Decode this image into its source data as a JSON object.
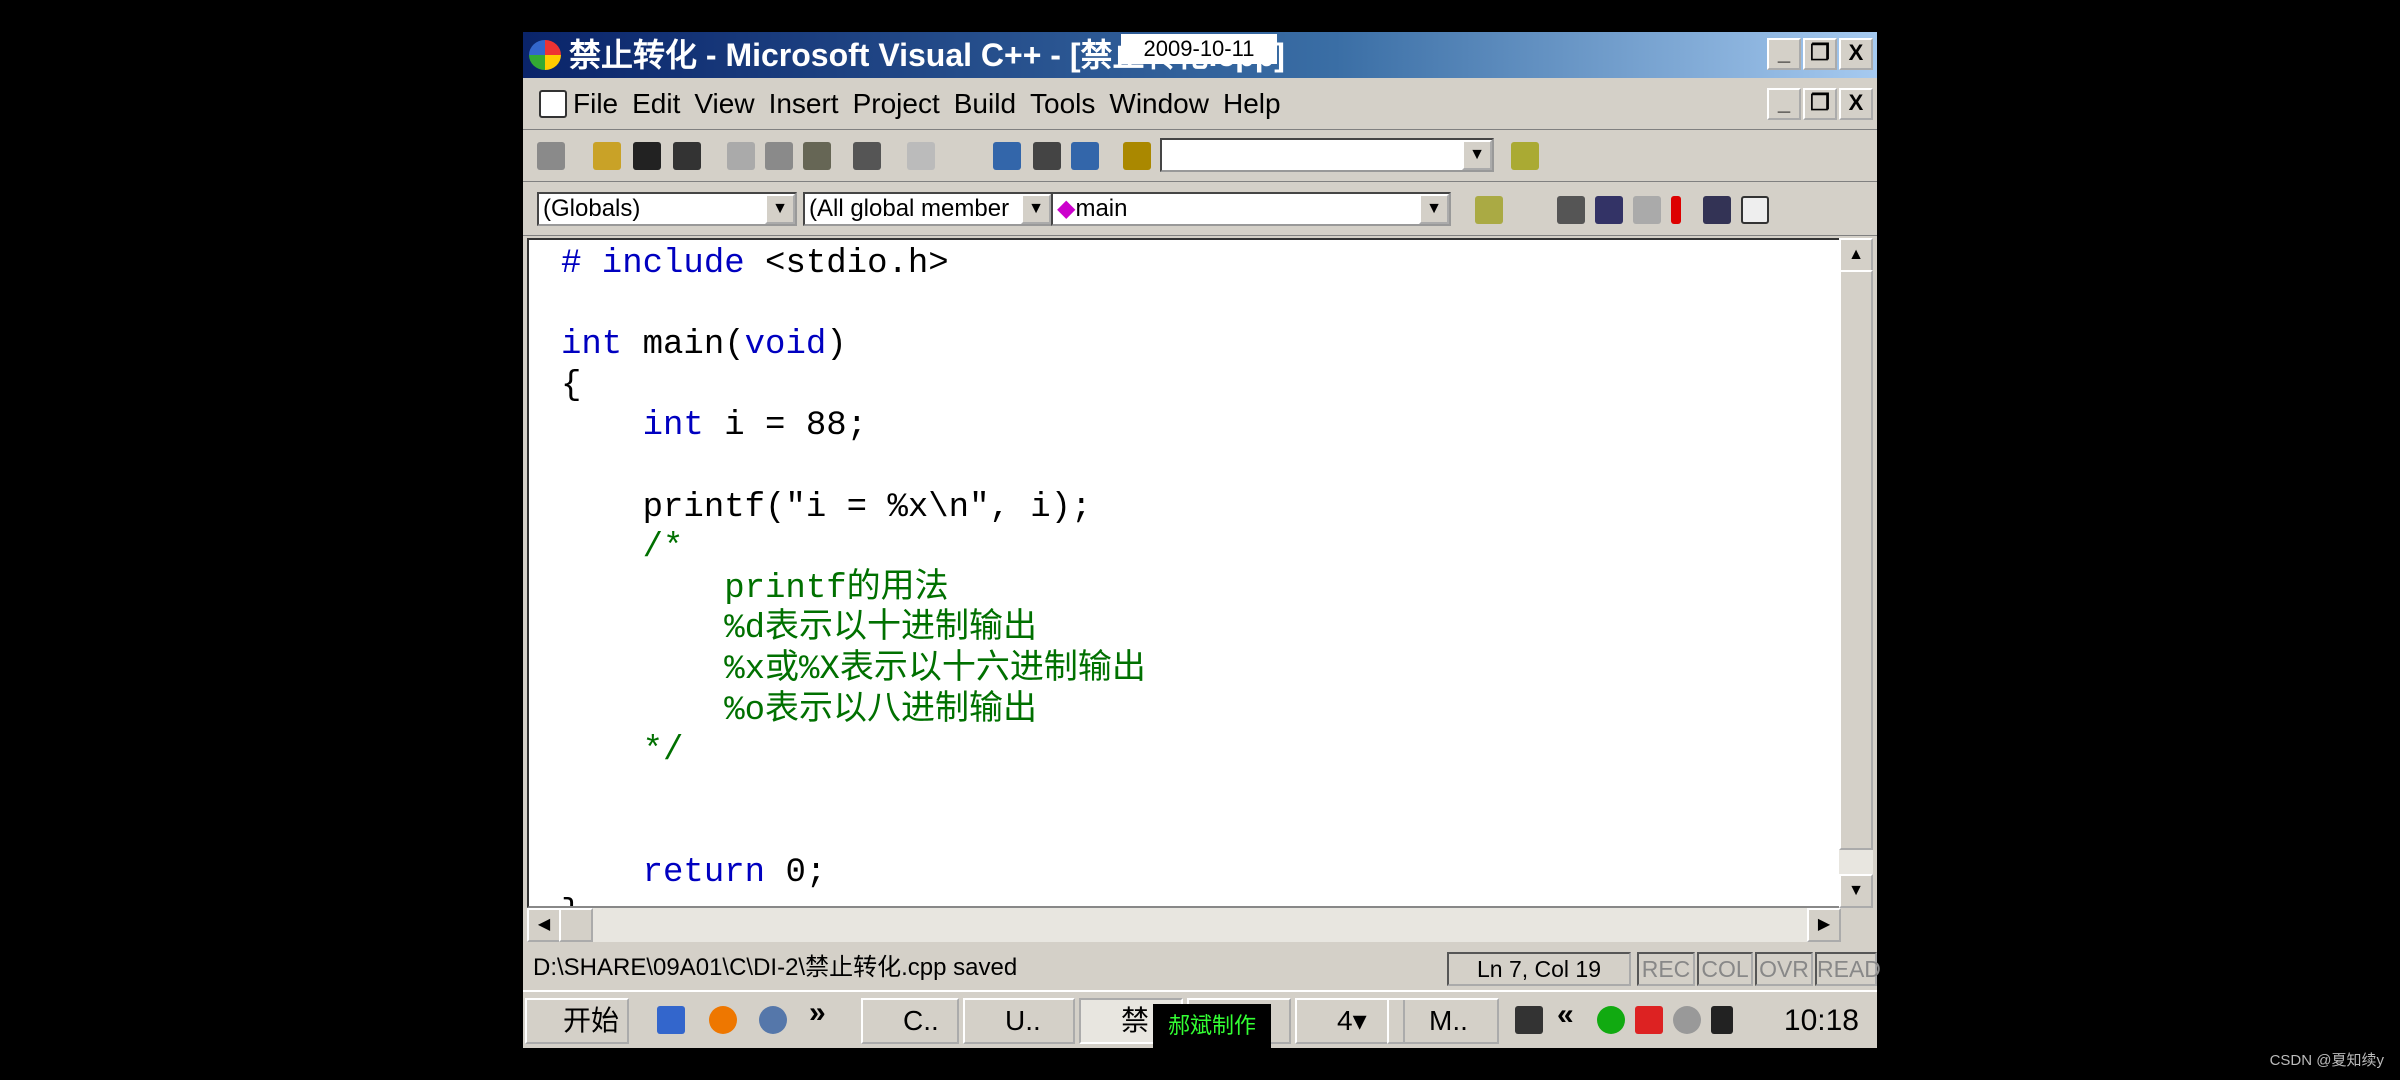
{
  "window": {
    "title": "禁止转化 - Microsoft Visual C++ - [禁止转化.cpp]",
    "overlay_date": "2009-10-11",
    "minimize": "_",
    "restore": "❐",
    "close": "X"
  },
  "menu": [
    "File",
    "Edit",
    "View",
    "Insert",
    "Project",
    "Build",
    "Tools",
    "Window",
    "Help"
  ],
  "toolbar": {
    "find_value": "",
    "scope_combo": "(Globals)",
    "members_combo": "(All global member",
    "function_combo": "main"
  },
  "code": [
    [
      [
        "kw",
        "# include "
      ],
      [
        "t",
        "<stdio.h>"
      ]
    ],
    [],
    [
      [
        "kw",
        "int"
      ],
      [
        "t",
        " main("
      ],
      [
        "kw",
        "void"
      ],
      [
        "t",
        ")"
      ]
    ],
    [
      [
        "t",
        "{"
      ]
    ],
    [
      [
        "t",
        "    "
      ],
      [
        "kw",
        "int"
      ],
      [
        "t",
        " i = 88;"
      ]
    ],
    [],
    [
      [
        "t",
        "    printf(\"i = %x\\n\", i);"
      ]
    ],
    [
      [
        "cm",
        "    /*"
      ]
    ],
    [
      [
        "cm",
        "        printf的用法"
      ]
    ],
    [
      [
        "cm",
        "        %d表示以十进制输出"
      ]
    ],
    [
      [
        "cm",
        "        %x或%X表示以十六进制输出"
      ]
    ],
    [
      [
        "cm",
        "        %o表示以八进制输出"
      ]
    ],
    [
      [
        "cm",
        "    */"
      ]
    ],
    [],
    [],
    [
      [
        "t",
        "    "
      ],
      [
        "kw",
        "return"
      ],
      [
        "t",
        " 0;"
      ]
    ],
    [
      [
        "t",
        "}"
      ]
    ]
  ],
  "status": {
    "message": "D:\\SHARE\\09A01\\C\\DI-2\\禁止转化.cpp saved",
    "position": "Ln 7, Col 19",
    "rec": "REC",
    "col": "COL",
    "ovr": "OVR",
    "read": "READ"
  },
  "taskbar": {
    "start": "开始",
    "chevron": "»",
    "tasks": [
      "C..",
      "U..",
      "禁",
      "",
      "4▾",
      "M.."
    ],
    "tooltip": "郝斌制作",
    "tray_chevron": "«",
    "clock": "10:18"
  },
  "watermark": "CSDN @夏知续y",
  "colors": {
    "keyword": "#0000c0",
    "comment": "#007000",
    "title_bar": "#0a246a"
  }
}
